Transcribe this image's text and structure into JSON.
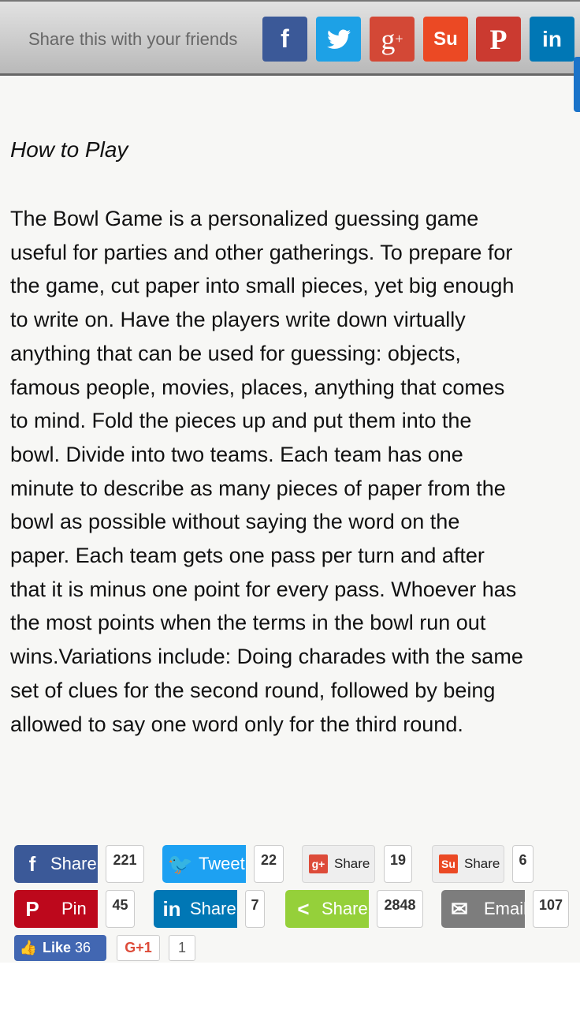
{
  "topbar": {
    "label": "Share this with your friends",
    "icons": [
      {
        "name": "facebook-icon",
        "glyph": "f",
        "color": "#3b5998"
      },
      {
        "name": "twitter-icon",
        "glyph": "🐦",
        "color": "#1da1e6"
      },
      {
        "name": "google-plus-icon",
        "glyph": "g+",
        "color": "#d34836"
      },
      {
        "name": "stumbleupon-icon",
        "glyph": "su",
        "color": "#eb4924"
      },
      {
        "name": "pinterest-icon",
        "glyph": "P",
        "color": "#cb2027"
      },
      {
        "name": "linkedin-icon",
        "glyph": "in",
        "color": "#0077b5"
      }
    ]
  },
  "article": {
    "heading": "How to Play",
    "lines": [
      "The Bowl Game is a personalized guessing game",
      "useful for parties and other gatherings. To prepare for",
      "the game, cut paper into small pieces, yet big enough",
      "to write on. Have the players write down virtually",
      "anything that can be used for guessing: objects,",
      "famous people, movies, places, anything that comes",
      "to mind. Fold the pieces up and put them into the",
      "bowl. Divide into two teams. Each team has one",
      "minute to describe as many pieces of paper from the",
      "bowl as possible without saying the word on the",
      "paper. Each team gets one pass per turn and after",
      "that it is minus one point for every pass. Whoever has",
      "the most points when the terms in the bowl run out",
      "wins.Variations include: Doing charades with the same",
      "set of clues for the second round, followed by being",
      "allowed to say one word only for the third round."
    ]
  },
  "share": {
    "facebook": {
      "label": "Share",
      "count": "221",
      "color": "#3b5998"
    },
    "twitter": {
      "label": "Tweet",
      "count": "22",
      "color": "#1da1f2"
    },
    "googleplus": {
      "label": "Share",
      "count": "19",
      "color": "#dd4b39"
    },
    "stumbleupon": {
      "label": "Share",
      "count": "6",
      "color": "#eb4924"
    },
    "pinterest": {
      "label": "Pin",
      "count": "45",
      "color": "#bd081c"
    },
    "linkedin": {
      "label": "Share",
      "count": "7",
      "color": "#0077b5"
    },
    "sharethis": {
      "label": "Share",
      "count": "2848",
      "color": "#95d03a"
    },
    "email": {
      "label": "Email",
      "count": "107",
      "color": "#7d7d7d"
    },
    "like": {
      "label": "Like",
      "count": "36",
      "color": "#4267b2"
    },
    "plusone": {
      "label": "G+1",
      "count": "1"
    }
  }
}
